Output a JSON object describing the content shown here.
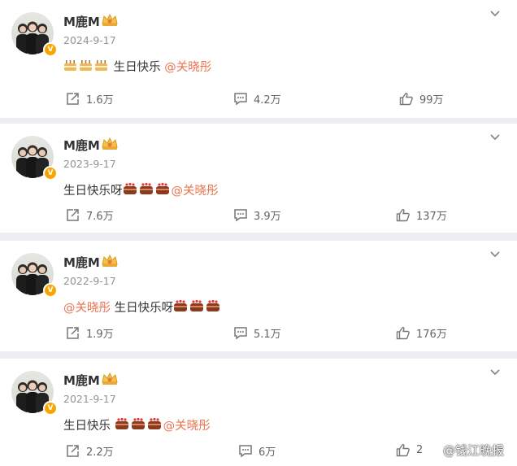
{
  "posts": [
    {
      "author": "M鹿M",
      "date": "2024-9-17",
      "text_before": "",
      "text_after": " 生日快乐 ",
      "cake_style": "yellow",
      "mention": "@关晓彤",
      "mention_first": false,
      "repost": "1.6万",
      "comments": "4.2万",
      "likes": "99万"
    },
    {
      "author": "M鹿M",
      "date": "2023-9-17",
      "text_before": "",
      "text_after": "生日快乐呀",
      "cake_style": "brown",
      "mention": "@关晓彤",
      "mention_first": false,
      "repost": "7.6万",
      "comments": "3.9万",
      "likes": "137万"
    },
    {
      "author": "M鹿M",
      "date": "2022-9-17",
      "text_before": "",
      "text_after": " 生日快乐呀",
      "cake_style": "brown",
      "mention": "@关晓彤",
      "mention_first": true,
      "repost": "1.9万",
      "comments": "5.1万",
      "likes": "176万"
    },
    {
      "author": "M鹿M",
      "date": "2021-9-17",
      "text_before": "",
      "text_after": "生日快乐 ",
      "cake_style": "brown",
      "mention": "@关晓彤",
      "mention_first": false,
      "repost": "2.2万",
      "comments": "6万",
      "likes": "2"
    }
  ],
  "watermark": "@钱江晚报",
  "icons": {
    "verified": "verified-v-icon",
    "crown": "crown-badge-icon",
    "cake": "birthday-cake-icon",
    "repost": "repost-icon",
    "comment": "comment-icon",
    "like": "thumbs-up-icon",
    "menu": "chevron-down-icon"
  },
  "colors": {
    "mention": "#eb7350",
    "date": "#939393",
    "badge": "#f7a500",
    "background": "#eceef1"
  }
}
